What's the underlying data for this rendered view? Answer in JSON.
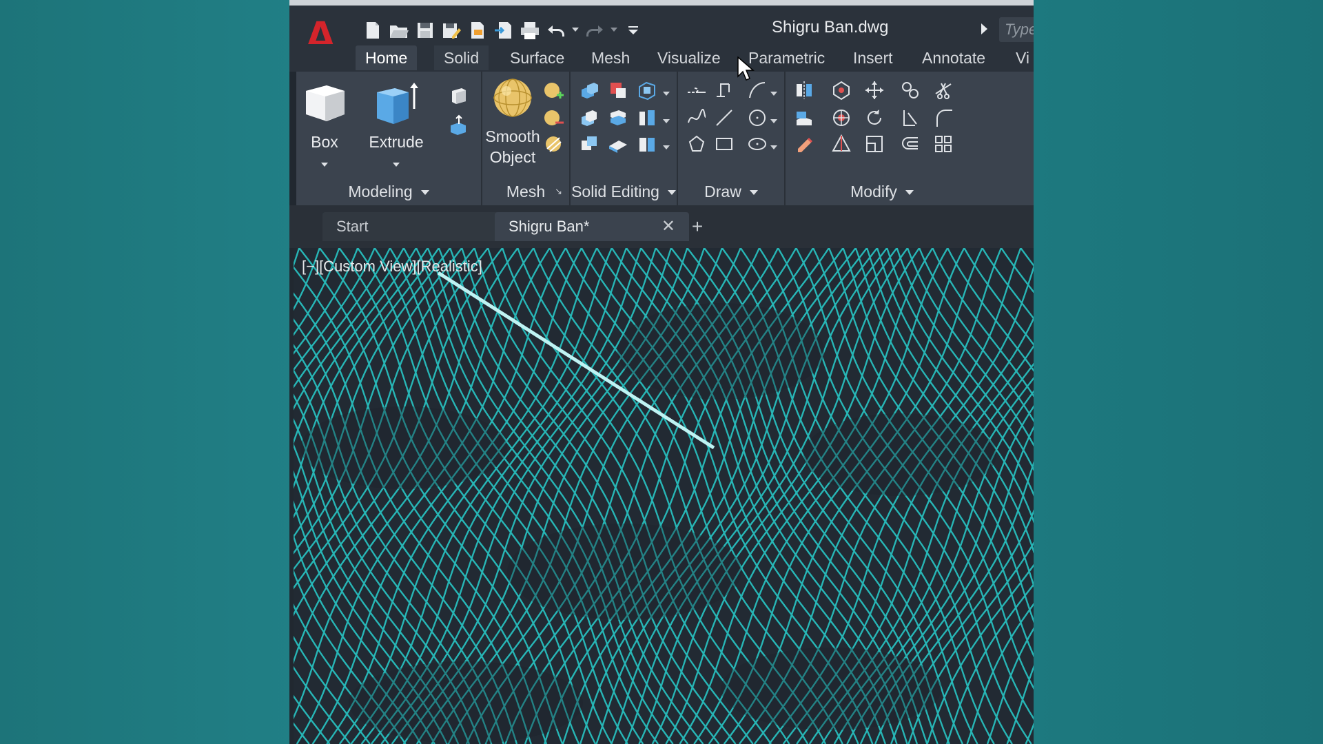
{
  "window": {
    "document_title": "Shigru Ban.dwg",
    "search_placeholder": "Type"
  },
  "app": {
    "logo_letter": "A"
  },
  "ribbon_tabs": [
    {
      "label": "Home",
      "active": true
    },
    {
      "label": "Solid",
      "active": false
    },
    {
      "label": "Surface",
      "active": false
    },
    {
      "label": "Mesh",
      "active": false
    },
    {
      "label": "Visualize",
      "active": false
    },
    {
      "label": "Parametric",
      "active": false
    },
    {
      "label": "Insert",
      "active": false
    },
    {
      "label": "Annotate",
      "active": false
    },
    {
      "label": "Vi",
      "active": false
    }
  ],
  "panels": {
    "modeling": {
      "title": "Modeling",
      "box_label": "Box",
      "extrude_label": "Extrude"
    },
    "mesh": {
      "title": "Mesh",
      "smooth_label_1": "Smooth",
      "smooth_label_2": "Object"
    },
    "solid_editing": {
      "title": "Solid Editing"
    },
    "draw": {
      "title": "Draw"
    },
    "modify": {
      "title": "Modify"
    }
  },
  "doc_tabs": {
    "start": "Start",
    "current": "Shigru Ban*",
    "close_glyph": "✕",
    "new_glyph": "+"
  },
  "viewport": {
    "label": "[−][Custom View][Realistic]",
    "mesh_color": "#27b6b6",
    "background": "#222a33"
  },
  "colors": {
    "accent_red": "#d4242b",
    "ribbon_bg": "#3b434e",
    "backdrop": "#1f7a80"
  }
}
